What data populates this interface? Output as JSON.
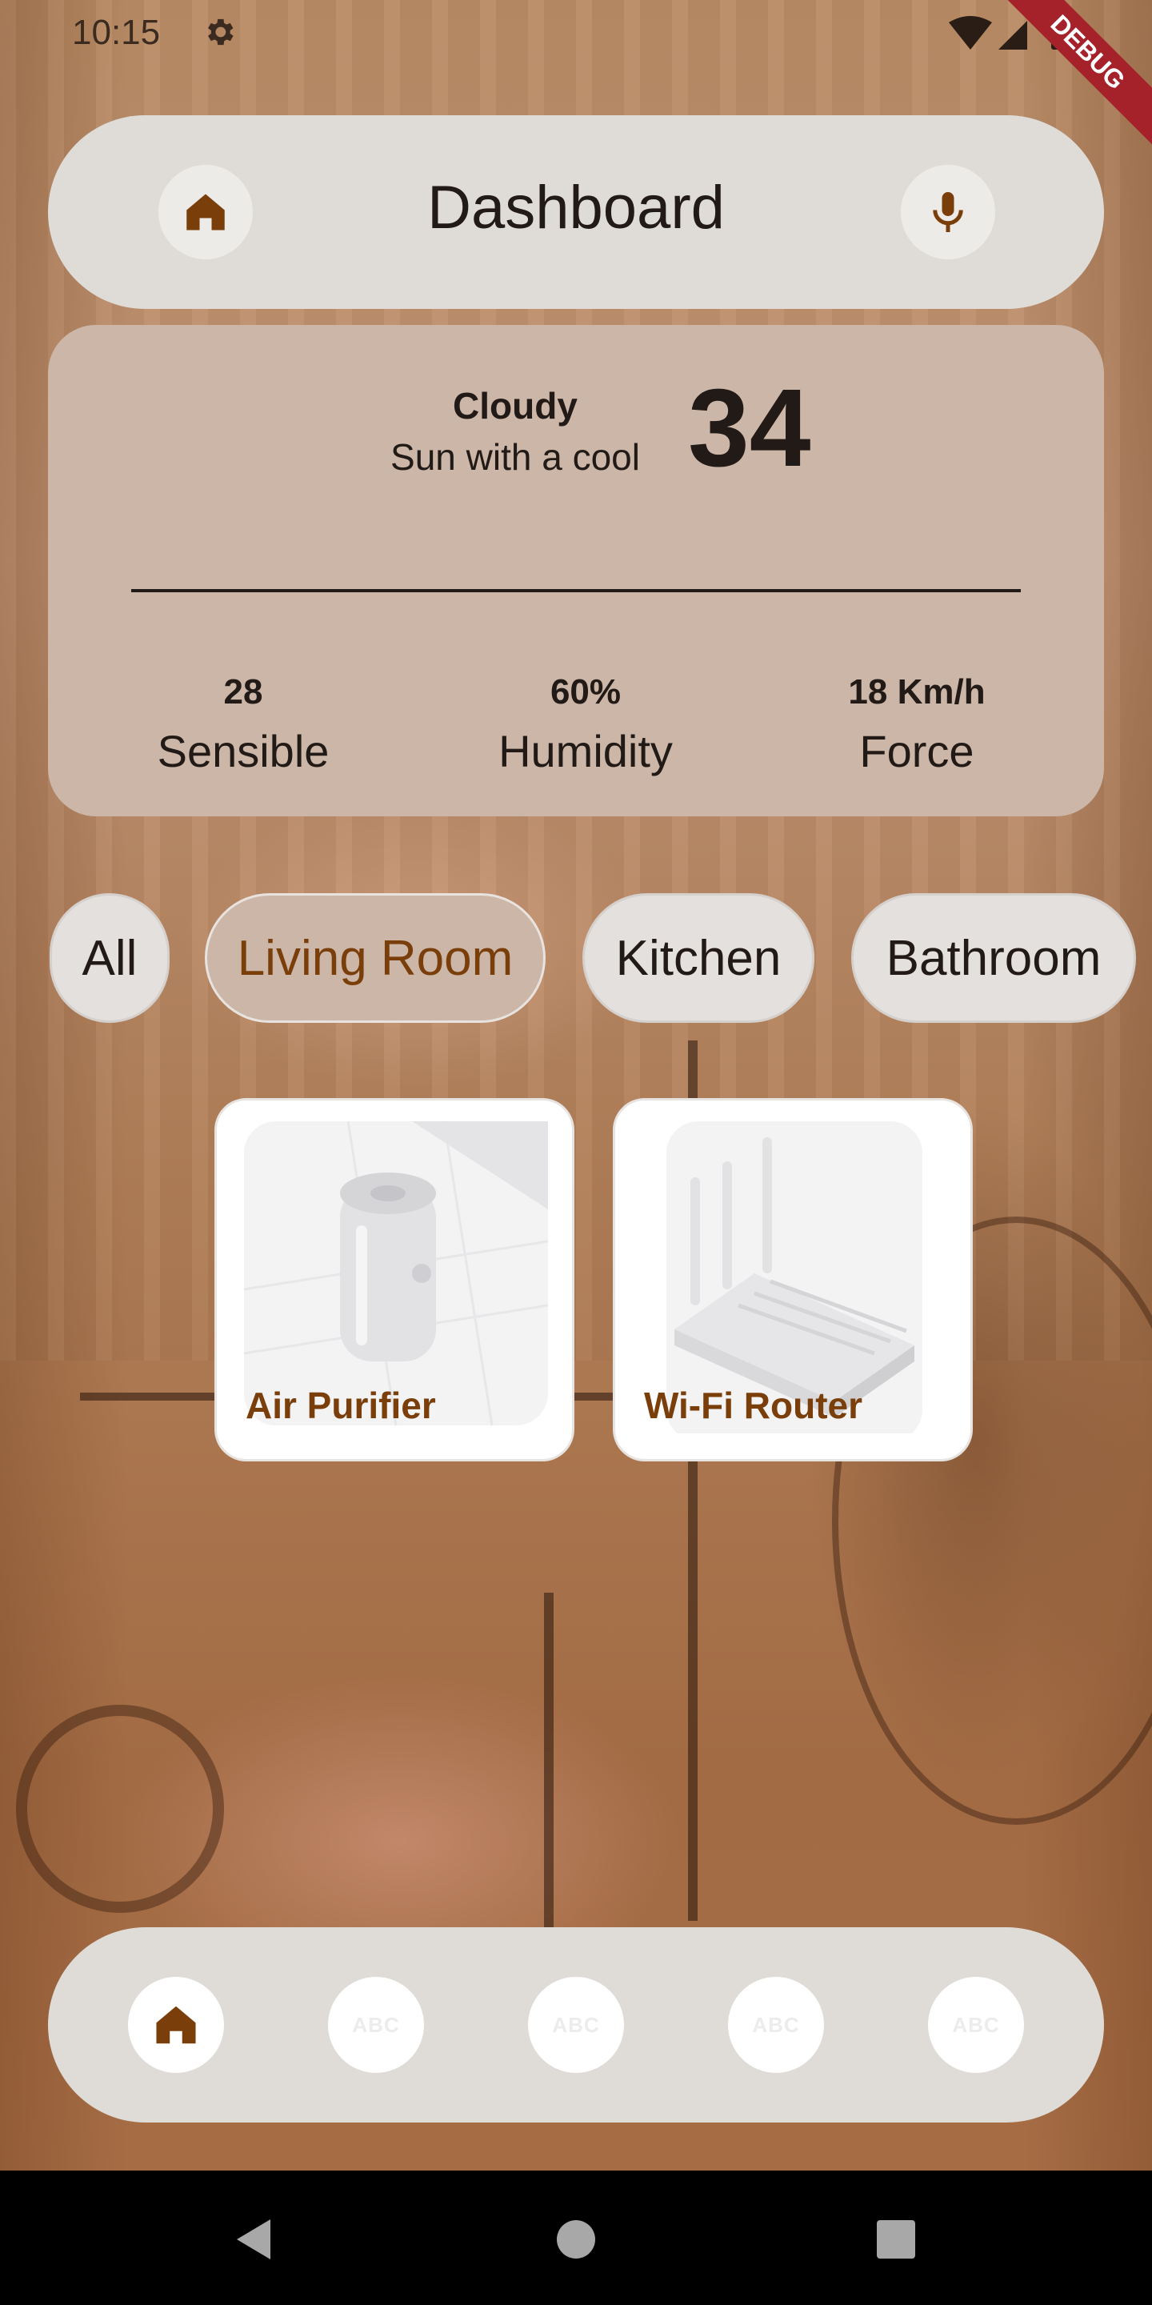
{
  "status_bar": {
    "time": "10:15",
    "debug_label": "DEBUG"
  },
  "header": {
    "title": "Dashboard",
    "home_icon": "home-icon",
    "mic_icon": "microphone-icon"
  },
  "weather": {
    "condition": "Cloudy",
    "description": "Sun with a cool",
    "temperature": "34",
    "stats": [
      {
        "value": "28",
        "label": "Sensible"
      },
      {
        "value": "60%",
        "label": "Humidity"
      },
      {
        "value": "18 Km/h",
        "label": "Force"
      }
    ]
  },
  "rooms": {
    "chips": [
      "All",
      "Living Room",
      "Kitchen",
      "Bathroom"
    ],
    "selected": "Living Room"
  },
  "devices": [
    {
      "name": "Air Purifier",
      "icon": "air-purifier-icon"
    },
    {
      "name": "Wi-Fi Router",
      "icon": "wifi-router-icon"
    }
  ],
  "bottom_nav": {
    "items": [
      {
        "icon": "home-icon",
        "label": ""
      },
      {
        "icon": "placeholder-icon",
        "label": "ABC"
      },
      {
        "icon": "placeholder-icon",
        "label": "ABC"
      },
      {
        "icon": "placeholder-icon",
        "label": "ABC"
      },
      {
        "icon": "placeholder-icon",
        "label": "ABC"
      }
    ]
  },
  "colors": {
    "accent": "#7a3e0a",
    "card": "#cbb6a7",
    "surface": "#dfdcd8",
    "text": "#211a16"
  }
}
